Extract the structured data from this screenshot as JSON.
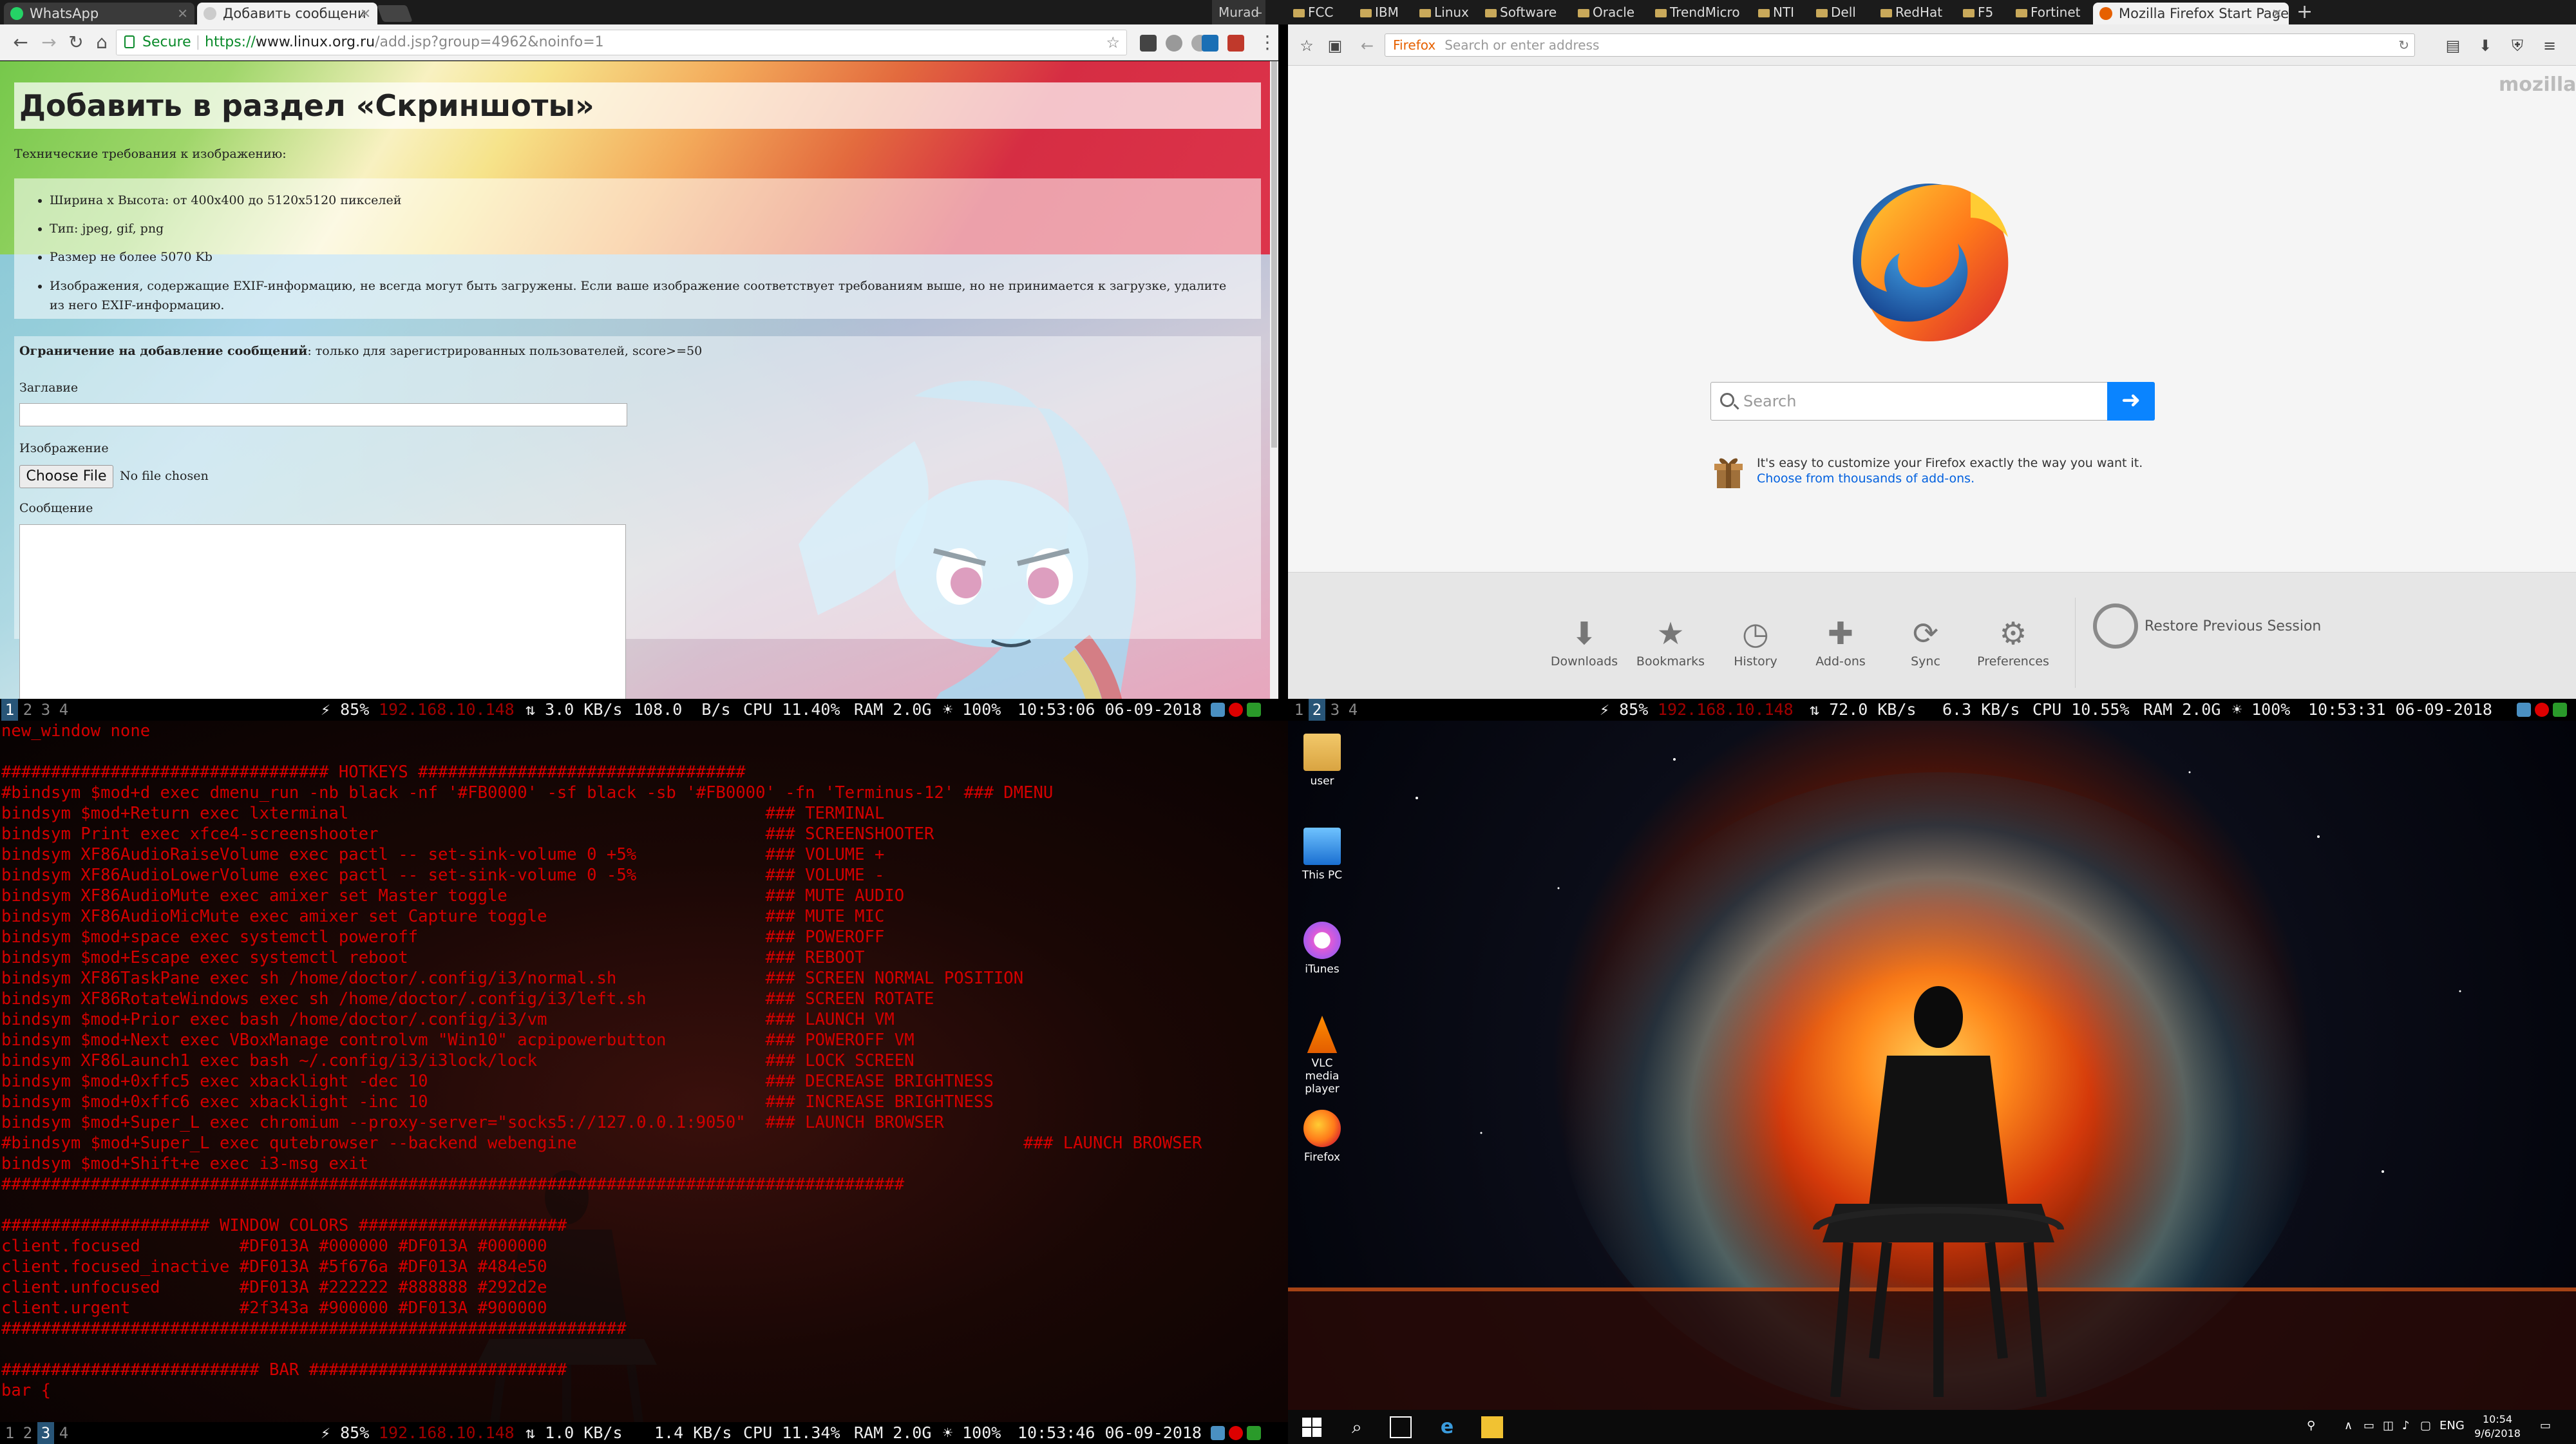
{
  "chrome": {
    "tabs": [
      {
        "title": "WhatsApp",
        "active": false
      },
      {
        "title": "Добавить сообщени",
        "active": true
      }
    ],
    "user": "Murad",
    "url": {
      "secure_label": "Secure",
      "scheme": "https://",
      "host": "www.linux.org.ru",
      "path": "/add.jsp?group=4962&noinfo=1"
    }
  },
  "bookmarks": [
    "FCC",
    "IBM",
    "Linux",
    "Software",
    "Oracle",
    "TrendMicro",
    "NTI",
    "Dell",
    "RedHat",
    "F5",
    "Fortinet"
  ],
  "firefox_tab": {
    "title": "Mozilla Firefox Start Page"
  },
  "page": {
    "heading": "Добавить в раздел «Скриншоты»",
    "tech_req_label": "Технические требования к изображению:",
    "requirements": [
      "Ширина x Высота: от 400x400 до 5120x5120 пикселей",
      "Тип: jpeg, gif, png",
      "Размер не более 5070 Kb",
      "Изображения, содержащие EXIF-информацию, не всегда могут быть загружены. Если ваше изображение соответствует требованиям выше, но не принимается к загрузке, удалите из него EXIF-информацию."
    ],
    "restriction_bold": "Ограничение на добавление сообщений",
    "restriction_rest": ": только для зарегистрированных пользователей, score>=50",
    "title_label": "Заглавие",
    "image_label": "Изображение",
    "choose_file": "Choose File",
    "no_file": "No file chosen",
    "message_label": "Сообщение"
  },
  "firefox": {
    "url_brand": "Firefox",
    "url_placeholder": "Search or enter address",
    "mozilla": "mozilla",
    "search_placeholder": "Search",
    "tip": "It's easy to customize your Firefox exactly the way you want it.",
    "tip_link": "Choose from thousands of add-ons.",
    "buttons": [
      {
        "label": "Downloads",
        "icon": "download-icon",
        "glyph": "⬇"
      },
      {
        "label": "Bookmarks",
        "icon": "star-icon",
        "glyph": "★"
      },
      {
        "label": "History",
        "icon": "clock-icon",
        "glyph": "◷"
      },
      {
        "label": "Add-ons",
        "icon": "puzzle-icon",
        "glyph": "✚"
      },
      {
        "label": "Sync",
        "icon": "sync-icon",
        "glyph": "⟳"
      },
      {
        "label": "Preferences",
        "icon": "gear-icon",
        "glyph": "⚙"
      }
    ],
    "restore": "Restore Previous Session"
  },
  "i3bar_top_left": {
    "workspaces": [
      "1",
      "2",
      "3",
      "4"
    ],
    "active_ws": 0,
    "battery": "85%",
    "ip": "192.168.10.148",
    "net_down": "3.0 KB/s",
    "net_up": "108.0  B/s",
    "cpu": "CPU 11.40%",
    "ram": "RAM 2.0G",
    "brightness": "100%",
    "datetime": "10:53:06 06-09-2018"
  },
  "i3bar_top_right": {
    "workspaces": [
      "1",
      "2",
      "3",
      "4"
    ],
    "active_ws": 1,
    "battery": "85%",
    "ip": "192.168.10.148",
    "net_down": "72.0 KB/s",
    "net_up": "6.3 KB/s",
    "cpu": "CPU 10.55%",
    "ram": "RAM 2.0G",
    "brightness": "100%",
    "datetime": "10:53:31 06-09-2018"
  },
  "i3bar_bottom": {
    "workspaces": [
      "1",
      "2",
      "3",
      "4"
    ],
    "active_ws": 2,
    "battery": "85%",
    "ip": "192.168.10.148",
    "net_down": "1.0 KB/s",
    "net_up": "1.4 KB/s",
    "cpu": "CPU 11.34%",
    "ram": "RAM 2.0G",
    "brightness": "100%",
    "datetime": "10:53:46 06-09-2018"
  },
  "terminal": {
    "lines": [
      "new_window none",
      "",
      "################################# HOTKEYS #################################",
      "#bindsym $mod+d exec dmenu_run -nb black -nf '#FB0000' -sf black -sb '#FB0000' -fn 'Terminus-12' ### DMENU",
      "bindsym $mod+Return exec lxterminal                                          ### TERMINAL",
      "bindsym Print exec xfce4-screenshooter                                       ### SCREENSHOOTER",
      "bindsym XF86AudioRaiseVolume exec pactl -- set-sink-volume 0 +5%             ### VOLUME +",
      "bindsym XF86AudioLowerVolume exec pactl -- set-sink-volume 0 -5%             ### VOLUME -",
      "bindsym XF86AudioMute exec amixer set Master toggle                          ### MUTE AUDIO",
      "bindsym XF86AudioMicMute exec amixer set Capture toggle                      ### MUTE MIC",
      "bindsym $mod+space exec systemctl poweroff                                   ### POWEROFF",
      "bindsym $mod+Escape exec systemctl reboot                                    ### REBOOT",
      "bindsym XF86TaskPane exec sh /home/doctor/.config/i3/normal.sh               ### SCREEN NORMAL POSITION",
      "bindsym XF86RotateWindows exec sh /home/doctor/.config/i3/left.sh            ### SCREEN ROTATE",
      "bindsym $mod+Prior exec bash /home/doctor/.config/i3/vm                      ### LAUNCH VM",
      "bindsym $mod+Next exec VBoxManage controlvm \"Win10\" acpipowerbutton          ### POWEROFF VM",
      "bindsym XF86Launch1 exec bash ~/.config/i3/i3lock/lock                       ### LOCK SCREEN",
      "bindsym $mod+0xffc5 exec xbacklight -dec 10                                  ### DECREASE BRIGHTNESS",
      "bindsym $mod+0xffc6 exec xbacklight -inc 10                                  ### INCREASE BRIGHTNESS",
      "bindsym $mod+Super_L exec chromium --proxy-server=\"socks5://127.0.0.1:9050\"  ### LAUNCH BROWSER",
      "#bindsym $mod+Super_L exec qutebrowser --backend webengine                                             ### LAUNCH BROWSER",
      "bindsym $mod+Shift+e exec i3-msg exit",
      "###########################################################################################",
      "",
      "##################### WINDOW COLORS #####################",
      "client.focused          #DF013A #000000 #DF013A #000000",
      "client.focused_inactive #DF013A #5f676a #DF013A #484e50",
      "client.unfocused        #DF013A #222222 #888888 #292d2e",
      "client.urgent           #2f343a #900000 #DF013A #900000",
      "###############################################################",
      "",
      "########################## BAR ##########################",
      "bar {"
    ]
  },
  "desktop": {
    "icons": [
      {
        "label": "user",
        "icon": "user-folder-icon"
      },
      {
        "label": "This PC",
        "icon": "computer-icon"
      },
      {
        "label": "iTunes",
        "icon": "itunes-icon"
      },
      {
        "label": "VLC media player",
        "icon": "vlc-icon"
      },
      {
        "label": "Firefox",
        "icon": "firefox-icon"
      }
    ],
    "tray_lang": "ENG",
    "clock_time": "10:54",
    "clock_date": "9/6/2018"
  },
  "colors": {
    "term_red": "#d40000",
    "i3_ws_active": "#285577",
    "ff_blue": "#0a84ff"
  }
}
